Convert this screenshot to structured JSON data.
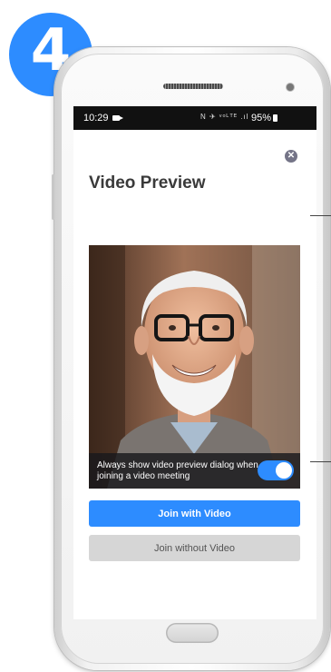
{
  "step": {
    "number": "4",
    "color": "#2d8cff"
  },
  "status_bar": {
    "time": "10:29",
    "video_icon": "video-camera-icon",
    "indicators": "N ✈ ᵛᵒᴸᵀᴱ .ıl",
    "battery": "95%",
    "battery_icon": "battery-icon"
  },
  "dialog": {
    "title": "Video Preview",
    "close_icon": "close-icon",
    "preview": {
      "toggle_label": "Always show video preview dialog when joining a video meeting",
      "toggle_on": true
    },
    "buttons": {
      "join_with_video": "Join with Video",
      "join_without_video": "Join without Video"
    }
  },
  "nav_bar": {
    "recent_icon": "recent-apps-icon",
    "home_icon": "home-icon",
    "back_icon": "back-icon"
  },
  "colors": {
    "accent": "#2d8cff",
    "secondary_button": "#d6d6d6",
    "close_button": "#747487",
    "status_bar": "#111111"
  }
}
